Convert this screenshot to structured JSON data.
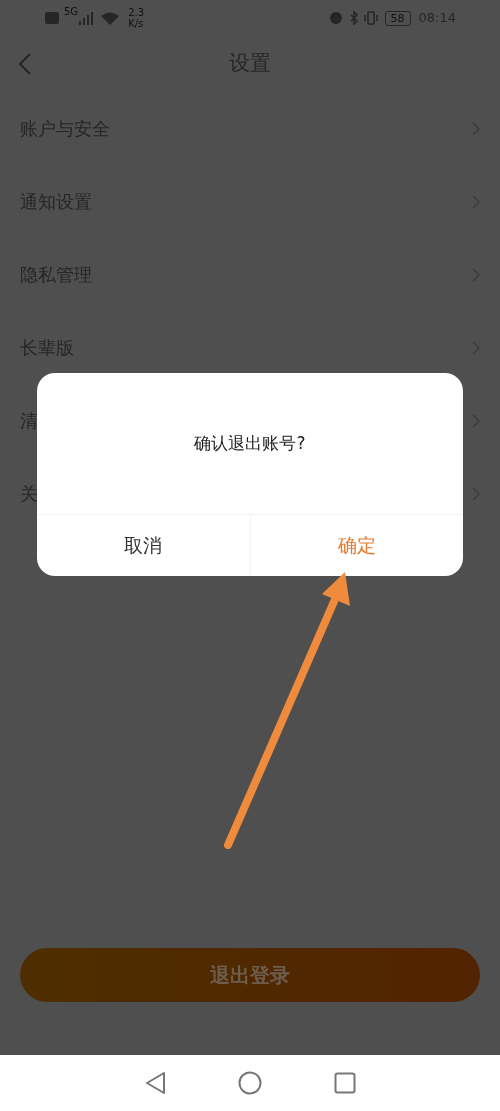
{
  "status_bar": {
    "network": "5G",
    "speed_value": "2.3",
    "speed_unit": "K/s",
    "battery": "58",
    "time": "08:14"
  },
  "header": {
    "title": "设置"
  },
  "settings_items": [
    {
      "label": "账户与安全"
    },
    {
      "label": "通知设置"
    },
    {
      "label": "隐私管理"
    },
    {
      "label": "长辈版"
    },
    {
      "label": "清"
    },
    {
      "label": "关"
    }
  ],
  "logout_button": {
    "label": "退出登录"
  },
  "dialog": {
    "message": "确认退出账号?",
    "buttons": [
      {
        "label": "取消",
        "kind": "cancel"
      },
      {
        "label": "确定",
        "kind": "confirm"
      }
    ]
  }
}
